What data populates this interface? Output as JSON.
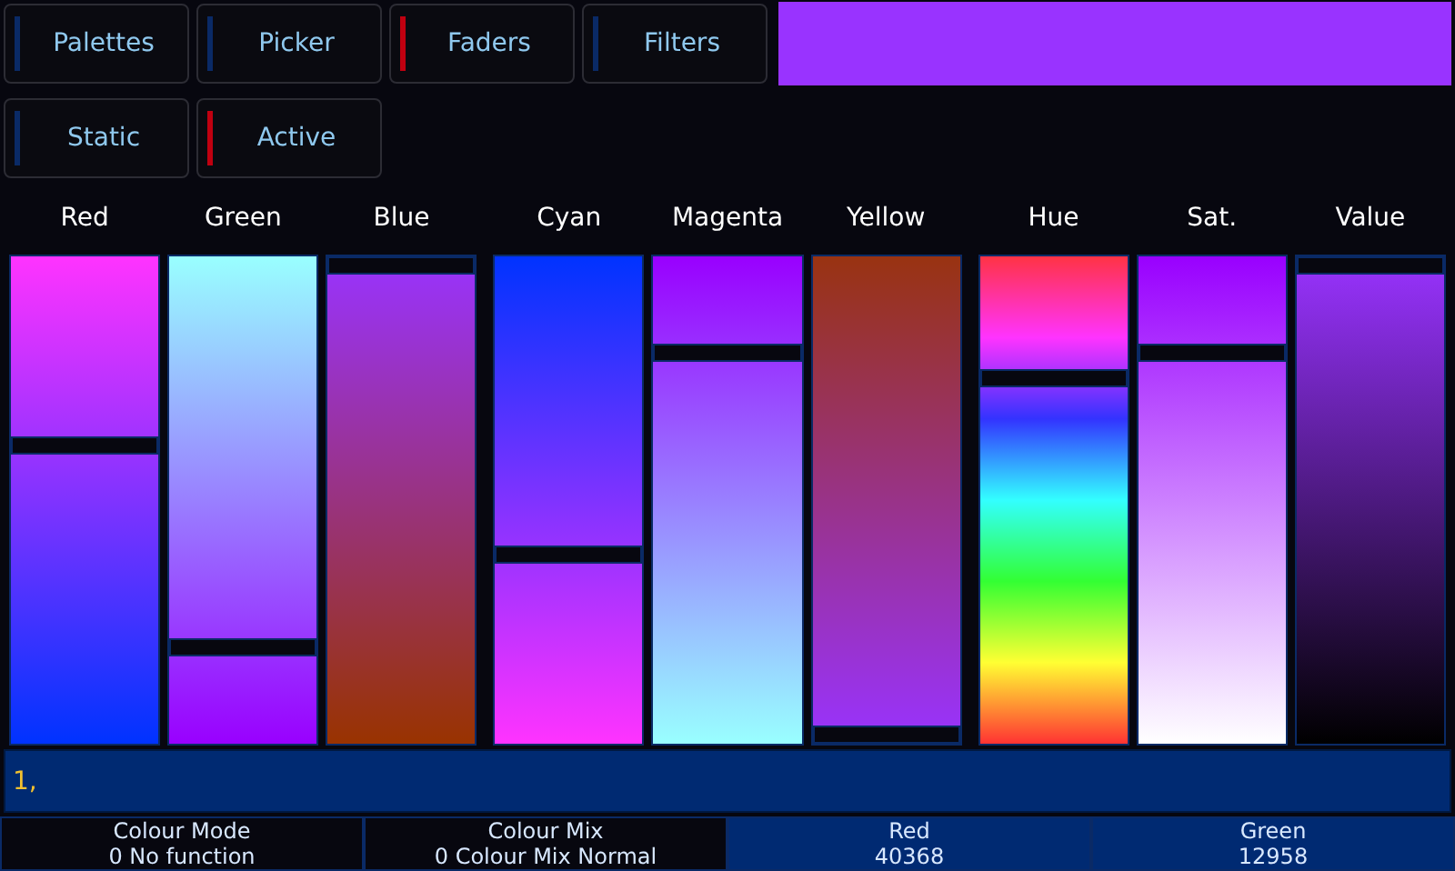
{
  "buttons": [
    [
      {
        "label": "Palettes",
        "active": false
      },
      {
        "label": "Picker",
        "active": false
      },
      {
        "label": "Faders",
        "active": true
      },
      {
        "label": "Filters",
        "active": false
      }
    ],
    [
      {
        "label": "Static",
        "active": false
      },
      {
        "label": "Active",
        "active": true
      }
    ]
  ],
  "swatch": {
    "color": "#9933ff"
  },
  "fader_groups": [
    [
      {
        "label": "Red",
        "level": 0.61,
        "kind": "red"
      },
      {
        "label": "Green",
        "level": 0.2,
        "kind": "green"
      },
      {
        "label": "Blue",
        "level": 0.98,
        "kind": "blue"
      }
    ],
    [
      {
        "label": "Cyan",
        "level": 0.39,
        "kind": "cyan"
      },
      {
        "label": "Magenta",
        "level": 0.8,
        "kind": "magenta"
      },
      {
        "label": "Yellow",
        "level": 0.02,
        "kind": "yellow"
      }
    ],
    [
      {
        "label": "Hue",
        "level": 0.75,
        "kind": "hue"
      },
      {
        "label": "Sat.",
        "level": 0.8,
        "kind": "saturation"
      },
      {
        "label": "Value",
        "level": 0.98,
        "kind": "value"
      }
    ]
  ],
  "command_line": "1,",
  "status_cells": [
    {
      "name": "Colour Mode",
      "value": "0 No function",
      "selected": false
    },
    {
      "name": "Colour Mix",
      "value": "0 Colour Mix Normal",
      "selected": false
    },
    {
      "name": "Red",
      "value": "40368",
      "selected": true
    },
    {
      "name": "Green",
      "value": "12958",
      "selected": true
    }
  ]
}
